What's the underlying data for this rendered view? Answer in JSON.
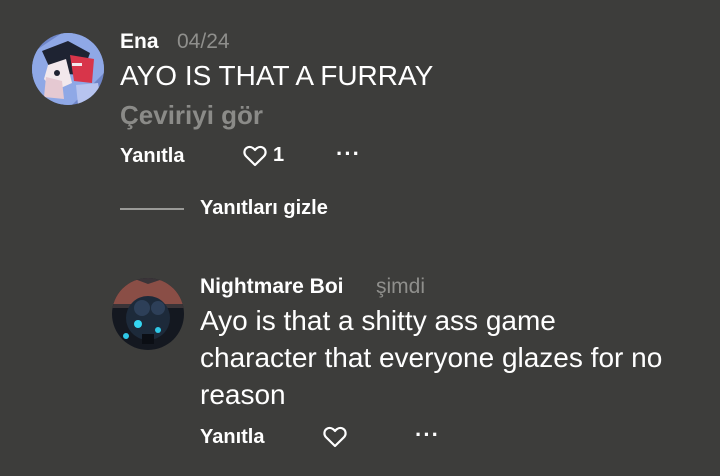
{
  "comments": [
    {
      "username": "Ena",
      "time": "04/24",
      "text": "AYO IS THAT A FURRAY",
      "translate_label": "Çeviriyi gör",
      "reply_label": "Yanıtla",
      "like_count": "1",
      "more_label": "···",
      "avatar_icon": "avatar-ena-icon"
    },
    {
      "username": "Nightmare Boi",
      "time": "şimdi",
      "text": "Ayo is that a shitty ass game character that everyone glazes for no reason",
      "reply_label": "Yanıtla",
      "more_label": "···",
      "avatar_icon": "avatar-nightmare-icon"
    }
  ],
  "replies_toggle": {
    "label": "Yanıtları gizle"
  },
  "colors": {
    "background": "#3d3d3b",
    "muted_text": "#8f8f8c"
  }
}
